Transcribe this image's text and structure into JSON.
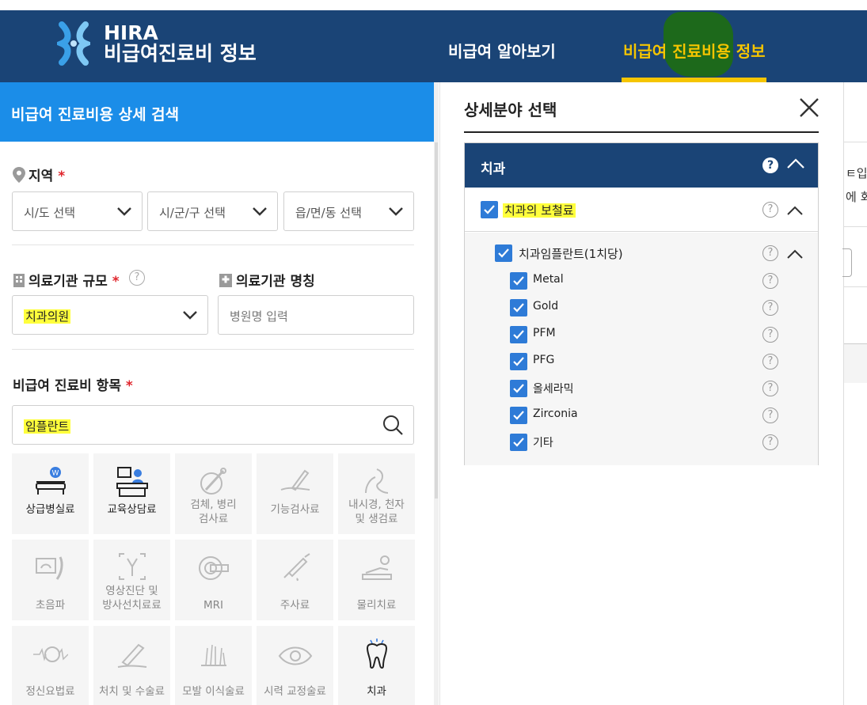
{
  "header": {
    "logo_line1": "HIRA",
    "logo_line2": "비급여진료비 정보",
    "nav": [
      {
        "label": "비급여 알아보기",
        "active": false
      },
      {
        "label": "비급여 진료비용 정보",
        "active": true
      }
    ],
    "accent": "#f5c500",
    "bg": "#1a4476"
  },
  "search_panel": {
    "title": "비급여 진료비용 상세 검색",
    "region": {
      "label": "지역",
      "required_mark": "*",
      "selects": [
        "시/도 선택",
        "시/군/구 선택",
        "읍/면/동 선택"
      ]
    },
    "facility_scale": {
      "label": "의료기관 규모",
      "required_mark": "*",
      "help": "?",
      "value": "치과의원"
    },
    "facility_name": {
      "label": "의료기관 명칭",
      "placeholder": "병원명 입력"
    },
    "item": {
      "label": "비급여 진료비 항목",
      "required_mark": "*",
      "value": "임플란트"
    },
    "categories": [
      {
        "label": "상급병실료",
        "icon": "hospital-bed-icon",
        "enabled": true
      },
      {
        "label": "교육상담료",
        "icon": "counseling-desk-icon",
        "enabled": true
      },
      {
        "label": "검체, 병리\n검사료",
        "icon": "specimen-icon",
        "enabled": false
      },
      {
        "label": "기능검사료",
        "icon": "function-test-icon",
        "enabled": false
      },
      {
        "label": "내시경, 천자\n및 생검료",
        "icon": "endoscope-icon",
        "enabled": false
      },
      {
        "label": "초음파",
        "icon": "ultrasound-icon",
        "enabled": false
      },
      {
        "label": "영상진단 및\n방사선치료료",
        "icon": "xray-icon",
        "enabled": false
      },
      {
        "label": "MRI",
        "icon": "mri-icon",
        "enabled": false
      },
      {
        "label": "주사료",
        "icon": "syringe-icon",
        "enabled": false
      },
      {
        "label": "물리치료",
        "icon": "physical-therapy-icon",
        "enabled": false
      },
      {
        "label": "정신요법료",
        "icon": "brain-icon",
        "enabled": false
      },
      {
        "label": "처치 및 수술료",
        "icon": "surgery-icon",
        "enabled": false
      },
      {
        "label": "모발 이식술료",
        "icon": "hair-transplant-icon",
        "enabled": false
      },
      {
        "label": "시력 교정술료",
        "icon": "eye-icon",
        "enabled": false
      },
      {
        "label": "치과",
        "icon": "tooth-icon",
        "enabled": true
      }
    ]
  },
  "modal": {
    "title": "상세분야 선택",
    "close_icon": "close-icon",
    "category": "치과",
    "help": "?",
    "group": {
      "label": "치과의 보철료",
      "checked": true
    },
    "subgroup": {
      "label": "치과임플란트(1치당)",
      "checked": true
    },
    "options": [
      {
        "label": "Metal",
        "checked": true
      },
      {
        "label": "Gold",
        "checked": true
      },
      {
        "label": "PFM",
        "checked": true
      },
      {
        "label": "PFG",
        "checked": true
      },
      {
        "label": "올세라믹",
        "checked": true
      },
      {
        "label": "Zirconia",
        "checked": true
      },
      {
        "label": "기타",
        "checked": true
      }
    ],
    "checkbox_color": "#2e7bd7"
  },
  "background_fragments": [
    "ㅌ입도",
    "에 회"
  ]
}
